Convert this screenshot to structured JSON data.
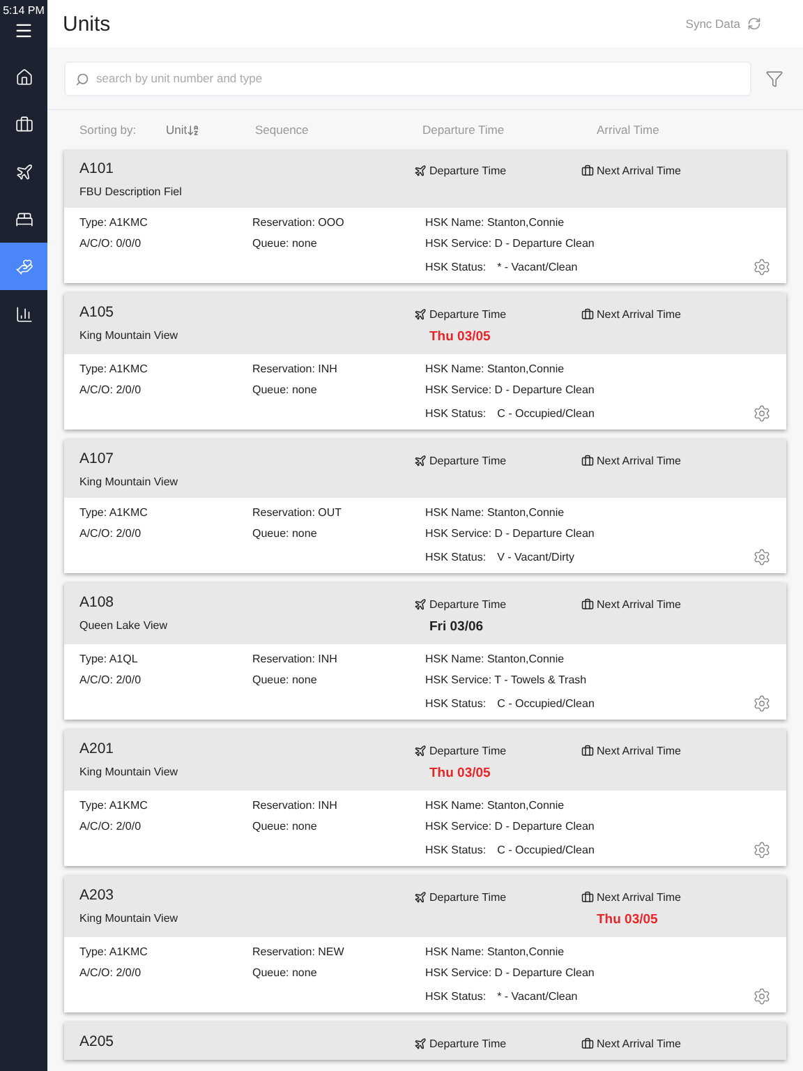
{
  "status_bar": {
    "time": "5:14 PM"
  },
  "sidebar": {
    "items": [
      {
        "kind": "home",
        "selected": false
      },
      {
        "kind": "luggage",
        "selected": false
      },
      {
        "kind": "plane",
        "selected": false
      },
      {
        "kind": "bed",
        "selected": false
      },
      {
        "kind": "housekeeping",
        "selected": true
      },
      {
        "kind": "chart",
        "selected": false
      }
    ]
  },
  "header": {
    "title": "Units",
    "sync_label": "Sync Data"
  },
  "search": {
    "placeholder": "search by unit number and type"
  },
  "sorting": {
    "label": "Sorting by:",
    "columns": [
      {
        "label": "Unit",
        "selected": true
      },
      {
        "label": "Sequence",
        "selected": false
      },
      {
        "label": "Departure Time",
        "selected": false
      },
      {
        "label": "Arrival Time",
        "selected": false
      }
    ]
  },
  "units": [
    {
      "code": "A101",
      "description": "FBU Description Fiel",
      "departure_label": "Departure Time",
      "arrival_label": "Next Arrival Time",
      "type": "Type: A1KMC",
      "aco": "A/C/O: 0/0/0",
      "reservation": "Reservation: OOO",
      "queue": "Queue: none",
      "hsk_name": "HSK Name: Stanton,Connie",
      "hsk_service": "HSK Service: D - Departure Clean",
      "hsk_status_label": "HSK Status:",
      "hsk_status": "* - Vacant/Clean"
    },
    {
      "code": "A105",
      "description": "King Mountain View",
      "departure_label": "Departure Time",
      "arrival_label": "Next Arrival Time",
      "departure": {
        "text": "Thu 03/05",
        "alert": true
      },
      "type": "Type: A1KMC",
      "aco": "A/C/O: 2/0/0",
      "reservation": "Reservation: INH",
      "queue": "Queue: none",
      "hsk_name": "HSK Name: Stanton,Connie",
      "hsk_service": "HSK Service: D - Departure Clean",
      "hsk_status_label": "HSK Status:",
      "hsk_status": "C - Occupied/Clean"
    },
    {
      "code": "A107",
      "description": "King Mountain View",
      "departure_label": "Departure Time",
      "arrival_label": "Next Arrival Time",
      "type": "Type: A1KMC",
      "aco": "A/C/O: 2/0/0",
      "reservation": "Reservation: OUT",
      "queue": "Queue: none",
      "hsk_name": "HSK Name: Stanton,Connie",
      "hsk_service": "HSK Service: D - Departure Clean",
      "hsk_status_label": "HSK Status:",
      "hsk_status": "V - Vacant/Dirty"
    },
    {
      "code": "A108",
      "description": "Queen Lake View",
      "departure_label": "Departure Time",
      "arrival_label": "Next Arrival Time",
      "departure": {
        "text": "Fri 03/06",
        "alert": false
      },
      "type": "Type: A1QL",
      "aco": "A/C/O: 2/0/0",
      "reservation": "Reservation: INH",
      "queue": "Queue: none",
      "hsk_name": "HSK Name: Stanton,Connie",
      "hsk_service": "HSK Service: T - Towels & Trash",
      "hsk_status_label": "HSK Status:",
      "hsk_status": "C - Occupied/Clean"
    },
    {
      "code": "A201",
      "description": "King Mountain View",
      "departure_label": "Departure Time",
      "arrival_label": "Next Arrival Time",
      "departure": {
        "text": "Thu 03/05",
        "alert": true
      },
      "type": "Type: A1KMC",
      "aco": "A/C/O: 2/0/0",
      "reservation": "Reservation: INH",
      "queue": "Queue: none",
      "hsk_name": "HSK Name: Stanton,Connie",
      "hsk_service": "HSK Service: D - Departure Clean",
      "hsk_status_label": "HSK Status:",
      "hsk_status": "C - Occupied/Clean"
    },
    {
      "code": "A203",
      "description": "King Mountain View",
      "departure_label": "Departure Time",
      "arrival_label": "Next Arrival Time",
      "arrival": {
        "text": "Thu 03/05",
        "alert": true
      },
      "type": "Type: A1KMC",
      "aco": "A/C/O: 2/0/0",
      "reservation": "Reservation: NEW",
      "queue": "Queue: none",
      "hsk_name": "HSK Name: Stanton,Connie",
      "hsk_service": "HSK Service: D - Departure Clean",
      "hsk_status_label": "HSK Status:",
      "hsk_status": "* - Vacant/Clean"
    },
    {
      "code": "A205",
      "departure_label": "Departure Time",
      "arrival_label": "Next Arrival Time"
    }
  ]
}
